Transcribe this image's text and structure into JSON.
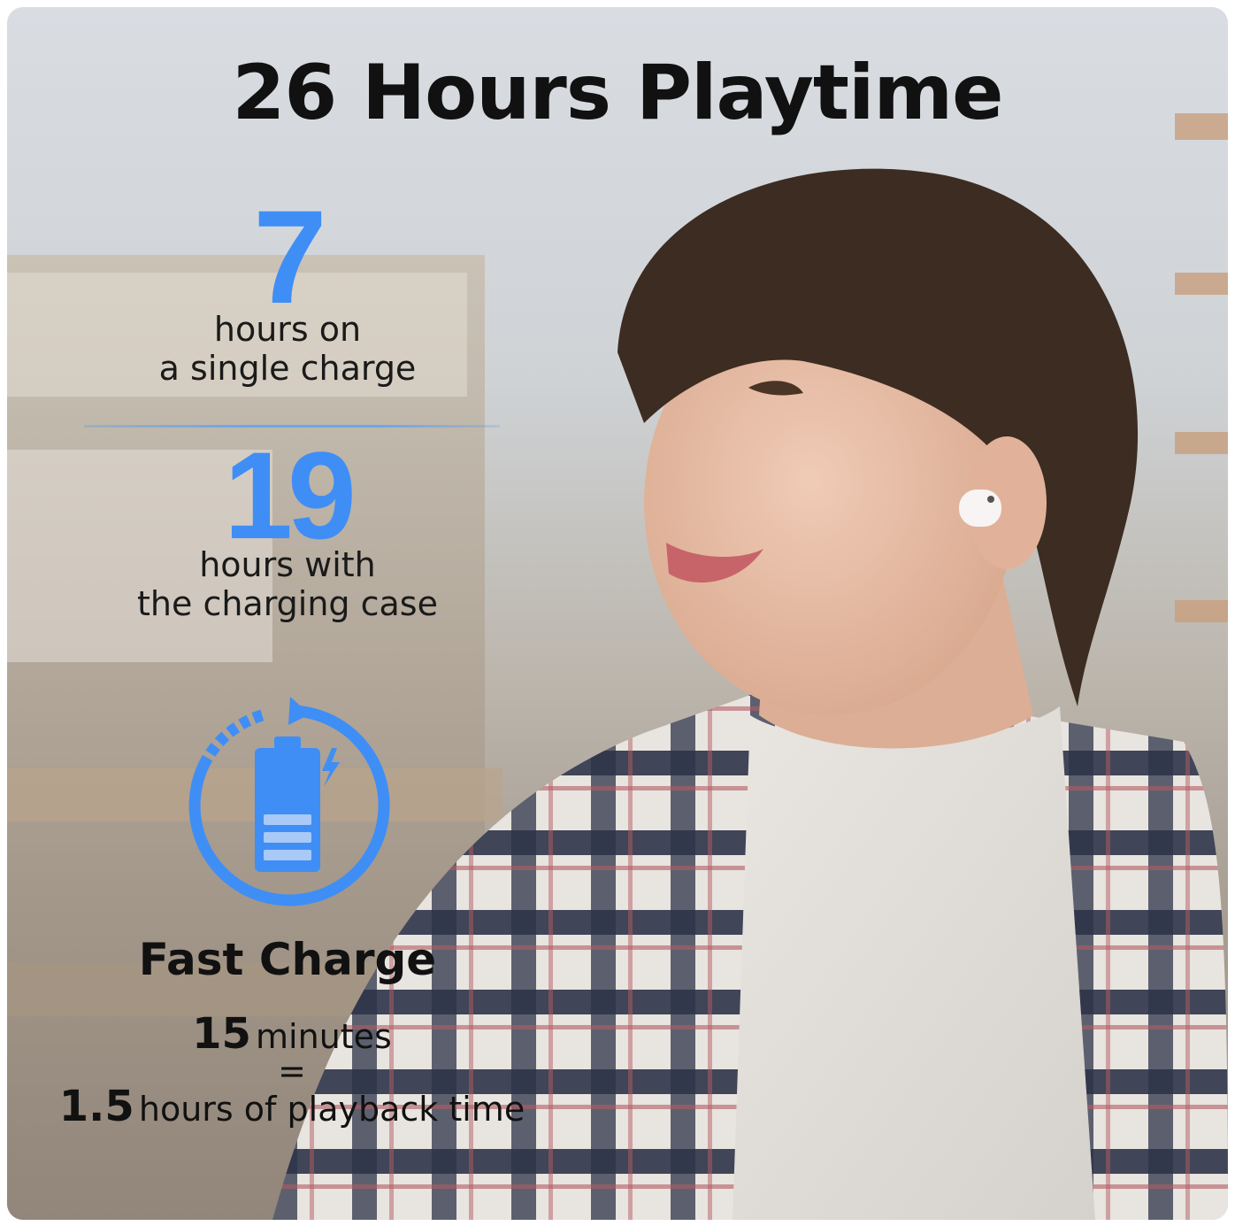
{
  "title": "26 Hours Playtime",
  "stats": [
    {
      "value": "7",
      "line1": "hours on",
      "line2": "a single charge"
    },
    {
      "value": "19",
      "line1": "hours with",
      "line2": "the charging case"
    }
  ],
  "fast_charge": {
    "title": "Fast Charge",
    "minutes_value": "15",
    "minutes_label": "minutes",
    "equals": "=",
    "hours_value": "1.5",
    "hours_label": "hours of playback time"
  },
  "colors": {
    "accent_blue": "#3f8ef5",
    "text_dark": "#111111"
  },
  "icons": [
    "battery-charging-icon",
    "refresh-arrow-icon"
  ]
}
